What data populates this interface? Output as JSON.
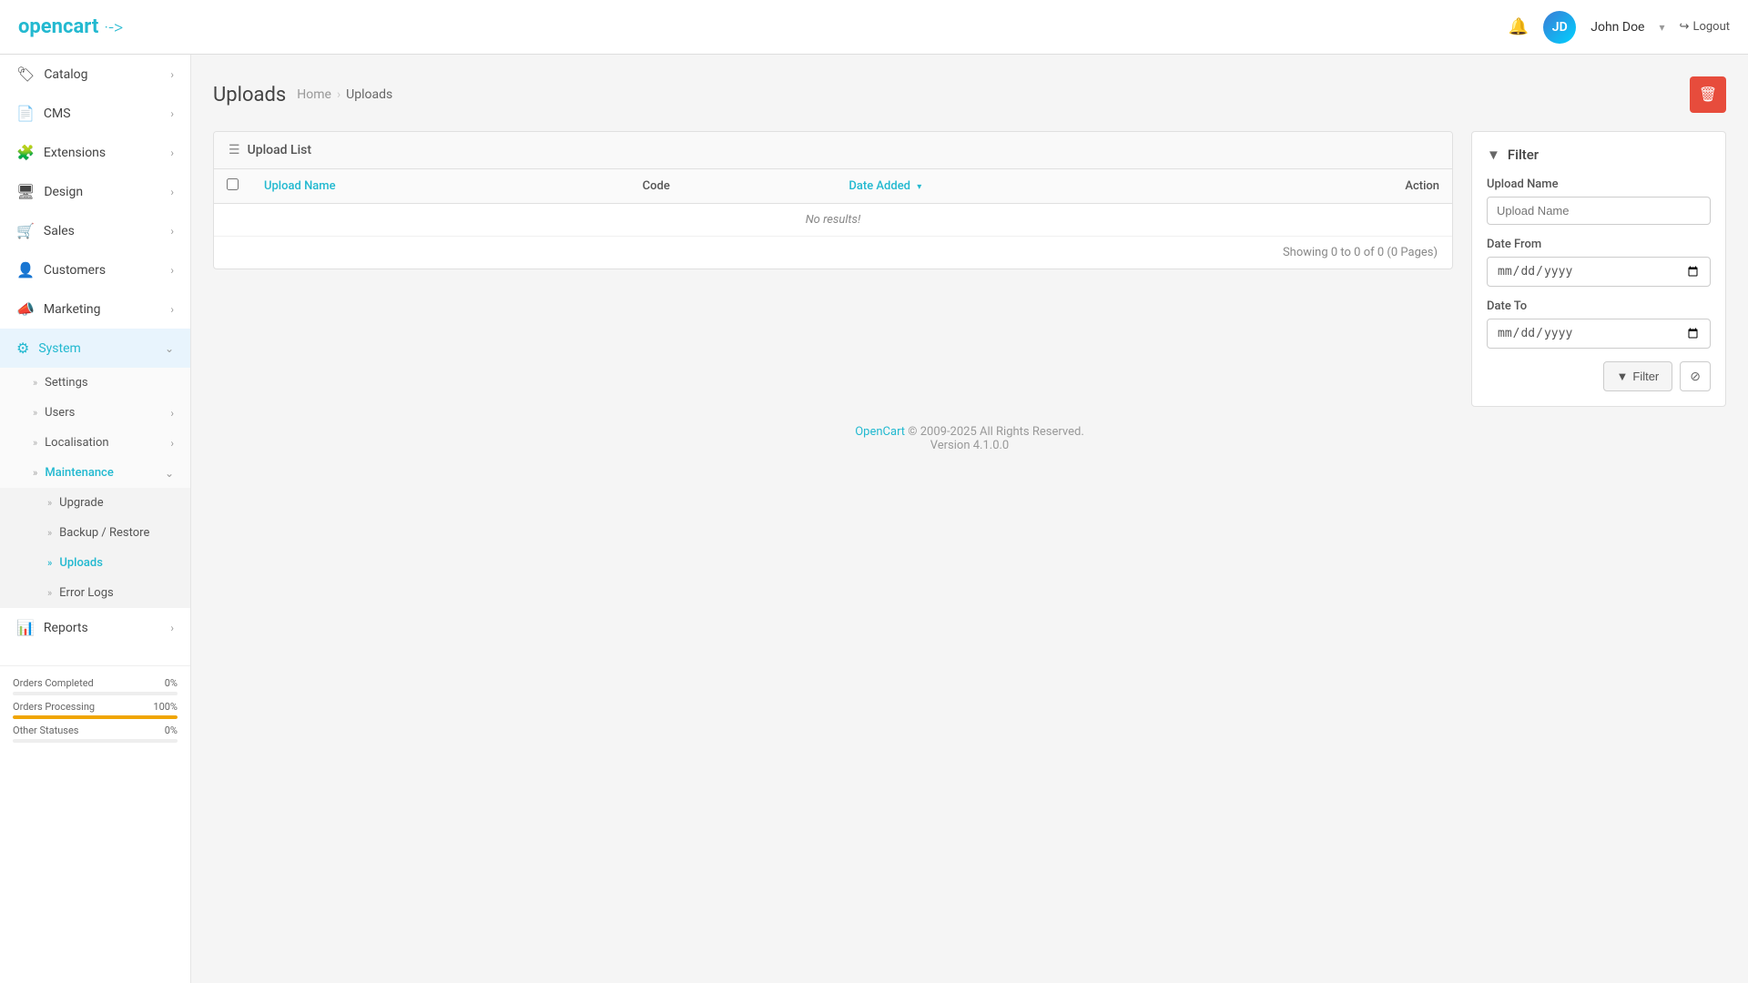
{
  "brand": {
    "name": "opencart",
    "logo_symbol": "·->"
  },
  "topnav": {
    "user_name": "John Doe",
    "logout_label": "Logout",
    "bell_label": "notifications"
  },
  "sidebar": {
    "items": [
      {
        "id": "catalog",
        "label": "Catalog",
        "icon": "tag",
        "has_children": true,
        "expanded": false
      },
      {
        "id": "cms",
        "label": "CMS",
        "icon": "file",
        "has_children": true,
        "expanded": false
      },
      {
        "id": "extensions",
        "label": "Extensions",
        "icon": "puzzle",
        "has_children": true,
        "expanded": false
      },
      {
        "id": "design",
        "label": "Design",
        "icon": "desktop",
        "has_children": true,
        "expanded": false
      },
      {
        "id": "sales",
        "label": "Sales",
        "icon": "cart",
        "has_children": true,
        "expanded": false
      },
      {
        "id": "customers",
        "label": "Customers",
        "icon": "user",
        "has_children": true,
        "expanded": false
      },
      {
        "id": "marketing",
        "label": "Marketing",
        "icon": "share",
        "has_children": true,
        "expanded": false
      },
      {
        "id": "system",
        "label": "System",
        "icon": "gear",
        "has_children": true,
        "expanded": true,
        "active": true
      },
      {
        "id": "reports",
        "label": "Reports",
        "icon": "chart",
        "has_children": true,
        "expanded": false
      }
    ],
    "system_children": [
      {
        "id": "settings",
        "label": "Settings",
        "has_children": false
      },
      {
        "id": "users",
        "label": "Users",
        "has_children": true
      },
      {
        "id": "localisation",
        "label": "Localisation",
        "has_children": true
      },
      {
        "id": "maintenance",
        "label": "Maintenance",
        "has_children": true,
        "expanded": true
      }
    ],
    "maintenance_children": [
      {
        "id": "upgrade",
        "label": "Upgrade"
      },
      {
        "id": "backup-restore",
        "label": "Backup / Restore"
      },
      {
        "id": "uploads",
        "label": "Uploads",
        "active": true
      },
      {
        "id": "error-logs",
        "label": "Error Logs"
      }
    ],
    "stats": [
      {
        "label": "Orders Completed",
        "value": "0%",
        "percent": 0,
        "color": "blue"
      },
      {
        "label": "Orders Processing",
        "value": "100%",
        "percent": 100,
        "color": "orange"
      },
      {
        "label": "Other Statuses",
        "value": "0%",
        "percent": 0,
        "color": "blue"
      }
    ]
  },
  "page": {
    "title": "Uploads",
    "breadcrumb_home": "Home",
    "breadcrumb_current": "Uploads"
  },
  "table": {
    "card_title": "Upload List",
    "columns": [
      {
        "key": "upload_name",
        "label": "Upload Name",
        "sortable": true,
        "color": "blue"
      },
      {
        "key": "code",
        "label": "Code",
        "sortable": false
      },
      {
        "key": "date_added",
        "label": "Date Added",
        "sortable": true,
        "sorted": true,
        "sort_dir": "desc",
        "color": "blue"
      },
      {
        "key": "action",
        "label": "Action",
        "sortable": false,
        "align": "right"
      }
    ],
    "no_results_text": "No results!",
    "showing_text": "Showing 0 to 0 of 0 (0 Pages)"
  },
  "filter": {
    "title": "Filter",
    "upload_name_label": "Upload Name",
    "upload_name_placeholder": "Upload Name",
    "date_from_label": "Date From",
    "date_from_placeholder": "mm/dd/yyyy",
    "date_to_label": "Date To",
    "date_to_placeholder": "mm/dd/yyyy",
    "filter_btn_label": "Filter",
    "clear_btn_label": "⊘"
  },
  "footer": {
    "brand": "OpenCart",
    "copyright": "© 2009-2025 All Rights Reserved.",
    "version": "Version 4.1.0.0"
  }
}
